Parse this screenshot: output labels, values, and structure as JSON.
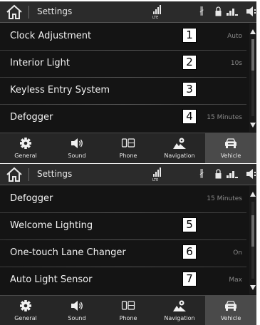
{
  "screens": [
    {
      "status": {
        "title": "Settings"
      },
      "rows": [
        {
          "label": "Clock Adjustment",
          "value": "Auto",
          "callout": "1"
        },
        {
          "label": "Interior Light",
          "value": "10s",
          "callout": "2"
        },
        {
          "label": "Keyless Entry System",
          "value": "",
          "callout": "3"
        },
        {
          "label": "Defogger",
          "value": "15 Minutes",
          "callout": "4"
        }
      ],
      "scroll_position": 0.0
    },
    {
      "status": {
        "title": "Settings"
      },
      "rows": [
        {
          "label": "Defogger",
          "value": "15 Minutes",
          "callout": ""
        },
        {
          "label": "Welcome Lighting",
          "value": "",
          "callout": "5"
        },
        {
          "label": "One-touch Lane Changer",
          "value": "On",
          "callout": "6"
        },
        {
          "label": "Auto Light Sensor",
          "value": "Max",
          "callout": "7"
        }
      ],
      "scroll_position": 0.3
    }
  ],
  "tabs": [
    {
      "label": "General",
      "icon": "gear-icon"
    },
    {
      "label": "Sound",
      "icon": "speaker-icon"
    },
    {
      "label": "Phone",
      "icon": "phone-icon"
    },
    {
      "label": "Navigation",
      "icon": "navigation-icon"
    },
    {
      "label": "Vehicle",
      "icon": "car-icon"
    }
  ],
  "active_tab": "Vehicle",
  "status_icons": [
    "home-icon",
    "lte-icon",
    "bluetooth-icon",
    "lock-icon",
    "signal-icon",
    "speaker-icon"
  ],
  "colors": {
    "background": "#141414",
    "status_bar": "#2b2b2b",
    "active_tab": "#4a4a4a",
    "callout_box": "#ffffff",
    "value_text": "#8a8a8a"
  }
}
